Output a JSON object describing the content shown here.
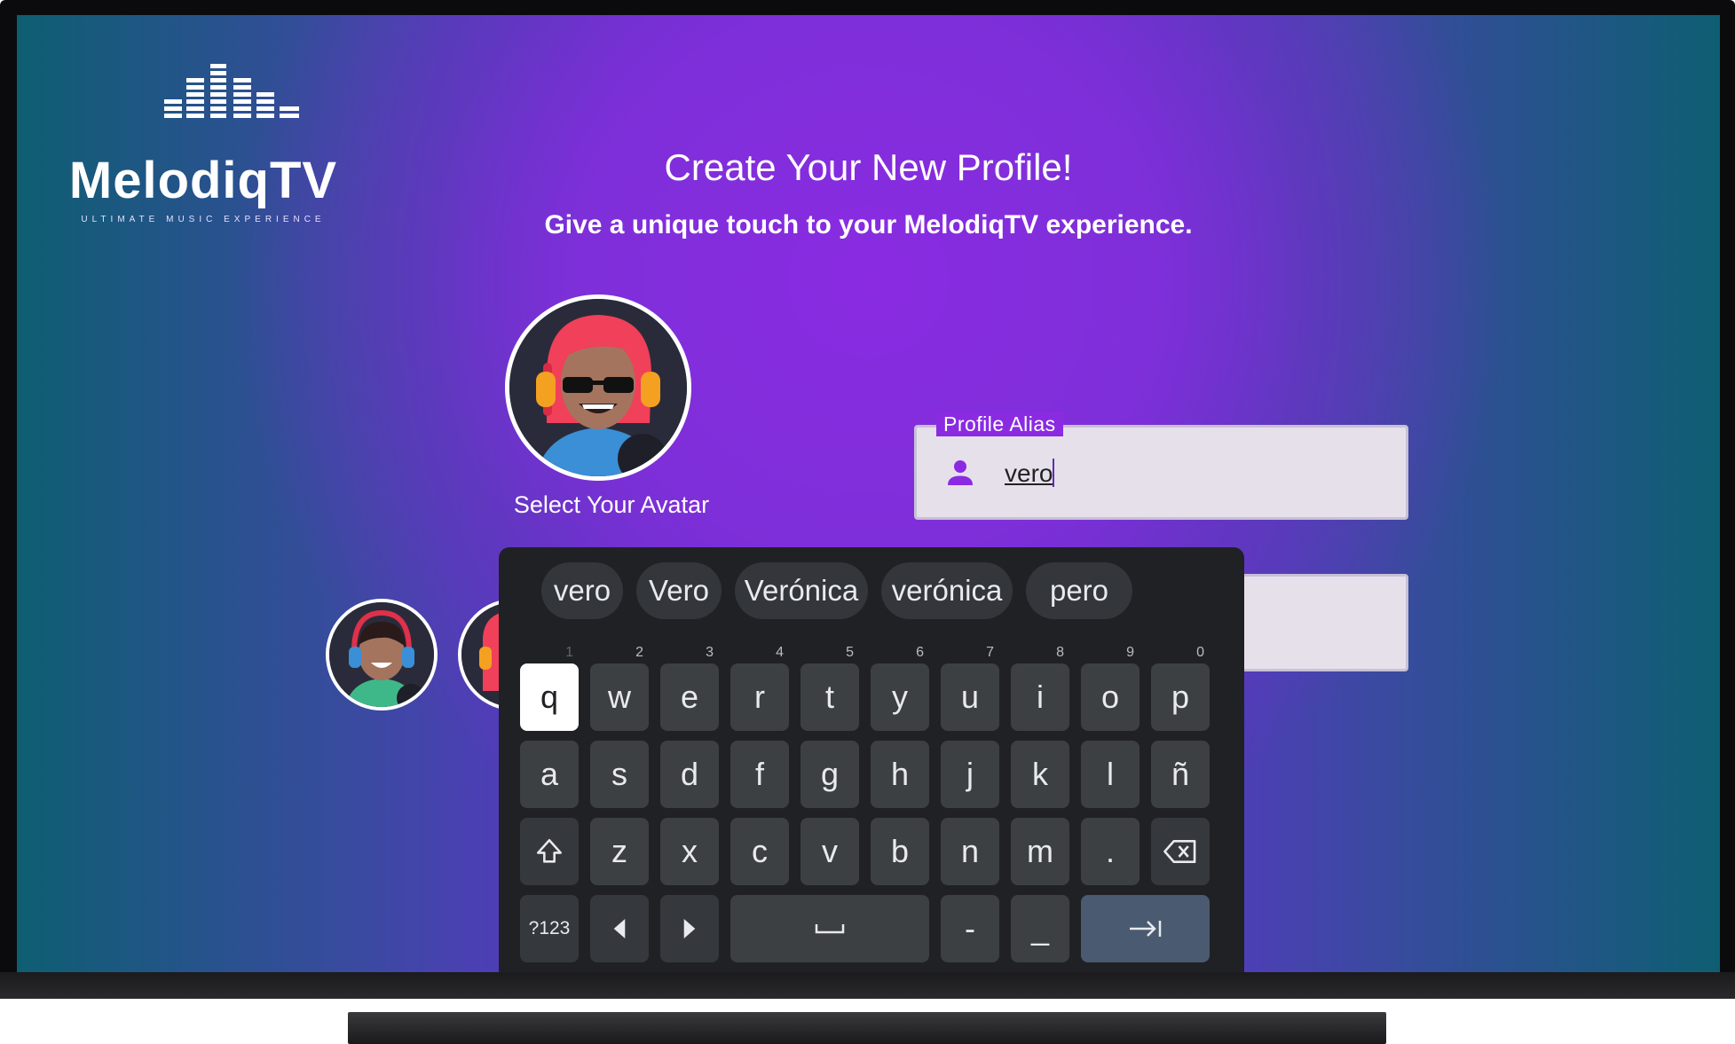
{
  "app": {
    "name": "MelodiqTV",
    "tagline": "ULTIMATE MUSIC EXPERIENCE"
  },
  "header": {
    "title": "Create Your New Profile!",
    "subtitle": "Give a unique touch to your MelodiqTV experience."
  },
  "avatar": {
    "label": "Select Your Avatar"
  },
  "alias_field": {
    "label": "Profile Alias",
    "value": "vero"
  },
  "keyboard": {
    "suggestions": [
      "vero",
      "Vero",
      "Verónica",
      "verónica",
      "pero"
    ],
    "row1": [
      {
        "key": "q",
        "hint": "1"
      },
      {
        "key": "w",
        "hint": "2"
      },
      {
        "key": "e",
        "hint": "3"
      },
      {
        "key": "r",
        "hint": "4"
      },
      {
        "key": "t",
        "hint": "5"
      },
      {
        "key": "y",
        "hint": "6"
      },
      {
        "key": "u",
        "hint": "7"
      },
      {
        "key": "i",
        "hint": "8"
      },
      {
        "key": "o",
        "hint": "9"
      },
      {
        "key": "p",
        "hint": "0"
      }
    ],
    "row2": [
      "a",
      "s",
      "d",
      "f",
      "g",
      "h",
      "j",
      "k",
      "l",
      "ñ"
    ],
    "row3": [
      "z",
      "x",
      "c",
      "v",
      "b",
      "n",
      "m",
      "."
    ],
    "symbols_key": "?123",
    "row4_extra": [
      "-",
      "_"
    ],
    "icons": [
      "shift-icon",
      "backspace-icon",
      "arrow-left-icon",
      "arrow-right-icon",
      "space-icon",
      "tab-next-icon",
      "person-icon"
    ]
  },
  "colors": {
    "accent": "#8a2be2",
    "keyboard_bg": "#202124",
    "key_bg": "#3c4043",
    "enter_key_bg": "#4a5a70",
    "field_bg": "#e6e0ea"
  }
}
